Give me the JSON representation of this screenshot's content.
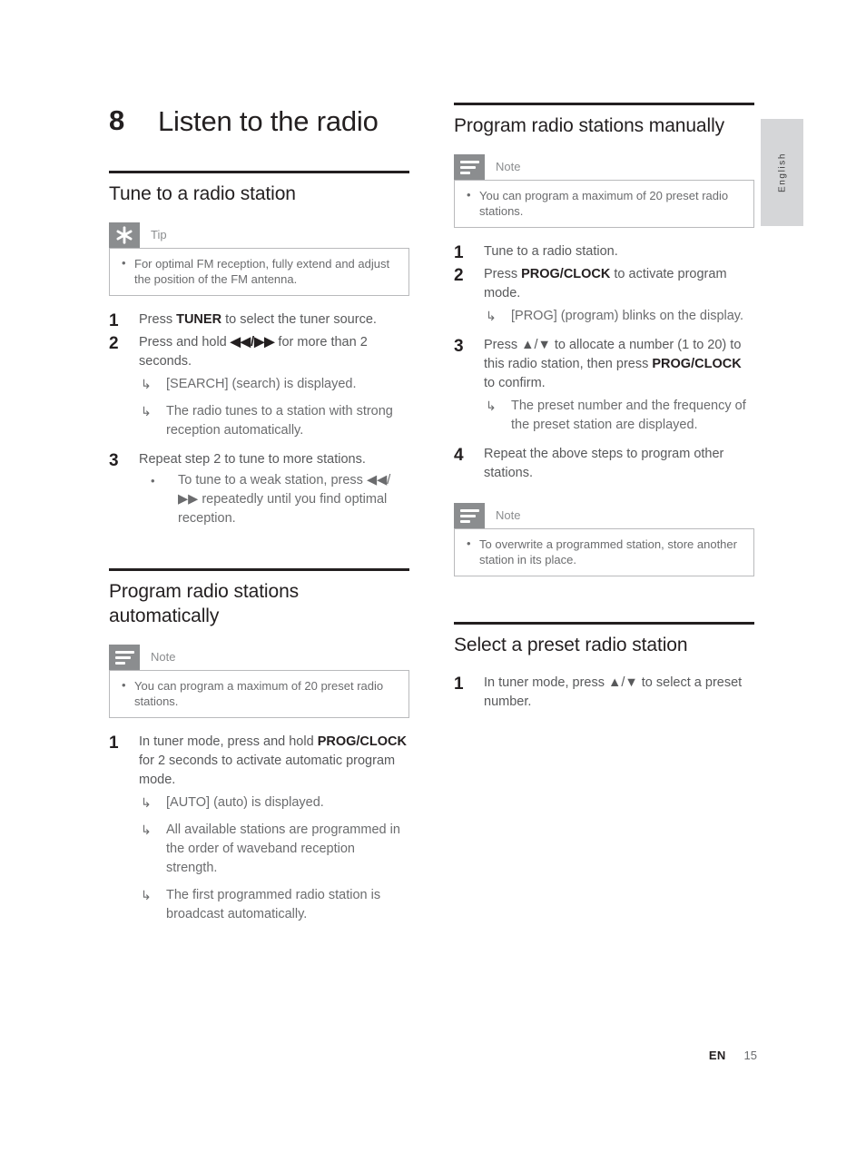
{
  "page": {
    "language_tab": "English",
    "footer": {
      "locale": "EN",
      "page_number": "15"
    }
  },
  "chapter": {
    "number": "8",
    "title": "Listen to the radio"
  },
  "left_column": {
    "sections": [
      {
        "heading": "Tune to a radio station",
        "callout": {
          "type": "tip",
          "icon": "asterisk-icon",
          "label": "Tip",
          "items": [
            "For optimal FM reception, fully extend and adjust the position of the FM antenna."
          ]
        },
        "steps": [
          {
            "number": "1",
            "text_parts": [
              {
                "t": "Press ",
                "bold": false
              },
              {
                "t": "TUNER",
                "bold": true
              },
              {
                "t": " to select the tuner source.",
                "bold": false
              }
            ],
            "results": []
          },
          {
            "number": "2",
            "text_parts": [
              {
                "t": "Press and hold ",
                "bold": false
              },
              {
                "t": "◀◀/▶▶",
                "bold": true
              },
              {
                "t": " for more than 2 seconds.",
                "bold": false
              }
            ],
            "results": [
              "[SEARCH] (search) is displayed.",
              "The radio tunes to a station with strong reception automatically."
            ]
          },
          {
            "number": "3",
            "text_parts": [
              {
                "t": "Repeat step 2 to tune to more stations.",
                "bold": false
              }
            ],
            "results": [],
            "subbullets": [
              "To tune to a weak station, press ◀◀/▶▶ repeatedly until you find optimal reception."
            ]
          }
        ]
      },
      {
        "heading": "Program radio stations automatically",
        "callout": {
          "type": "note",
          "icon": "note-lines-icon",
          "label": "Note",
          "items": [
            "You can program a maximum of 20 preset radio stations."
          ]
        },
        "steps": [
          {
            "number": "1",
            "text_parts": [
              {
                "t": "In tuner mode, press and hold ",
                "bold": false
              },
              {
                "t": "PROG/CLOCK",
                "bold": true
              },
              {
                "t": " for 2 seconds to activate automatic program mode.",
                "bold": false
              }
            ],
            "results": [
              "[AUTO] (auto) is displayed.",
              "All available stations are programmed in the order of waveband reception strength.",
              "The first programmed radio station is broadcast automatically."
            ]
          }
        ]
      }
    ]
  },
  "right_column": {
    "sections": [
      {
        "heading": "Program radio stations manually",
        "callout": {
          "type": "note",
          "icon": "note-lines-icon",
          "label": "Note",
          "items": [
            "You can program a maximum of 20 preset radio stations."
          ]
        },
        "steps": [
          {
            "number": "1",
            "text_parts": [
              {
                "t": "Tune to a radio station.",
                "bold": false
              }
            ],
            "results": []
          },
          {
            "number": "2",
            "text_parts": [
              {
                "t": "Press ",
                "bold": false
              },
              {
                "t": "PROG/CLOCK",
                "bold": true
              },
              {
                "t": " to activate program mode.",
                "bold": false
              }
            ],
            "results": [
              "[PROG] (program) blinks on the display."
            ]
          },
          {
            "number": "3",
            "text_parts": [
              {
                "t": "Press ▲/▼ to allocate a number (1 to 20) to this radio station, then press ",
                "bold": false
              },
              {
                "t": "PROG/CLOCK",
                "bold": true
              },
              {
                "t": " to confirm.",
                "bold": false
              }
            ],
            "results": [
              "The preset number and the frequency of the preset station are displayed."
            ]
          },
          {
            "number": "4",
            "text_parts": [
              {
                "t": "Repeat the above steps to program other stations.",
                "bold": false
              }
            ],
            "results": []
          }
        ],
        "trailing_callout": {
          "type": "note",
          "icon": "note-lines-icon",
          "label": "Note",
          "items": [
            "To overwrite a programmed station, store another station in its place."
          ]
        }
      },
      {
        "heading": "Select a preset radio station",
        "steps": [
          {
            "number": "1",
            "text_parts": [
              {
                "t": "In tuner mode, press ▲/▼ to select a preset number.",
                "bold": false
              }
            ],
            "results": []
          }
        ]
      }
    ]
  }
}
